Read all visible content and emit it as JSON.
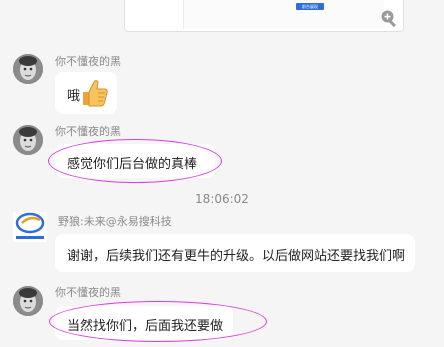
{
  "conversation": {
    "timestamp": "18:06:02",
    "top_image": {
      "button_label": "前台展现"
    },
    "messages": [
      {
        "sender": "你不懂夜的黑",
        "text": "哦",
        "emoji": "thumbs-up"
      },
      {
        "sender": "你不懂夜的黑",
        "text": "感觉你们后台做的真棒"
      },
      {
        "sender": "野狼:未来@永易搜科技",
        "text": "谢谢，后续我们还有更牛的升级。以后做网站还要找我们啊"
      },
      {
        "sender": "你不懂夜的黑",
        "text": "当然找你们，后面我还要做"
      }
    ]
  },
  "colors": {
    "background": "#f5f5f5",
    "bubble": "#ffffff",
    "annotation": "#d63fd8",
    "brand_logo": "#2f6ed8"
  }
}
